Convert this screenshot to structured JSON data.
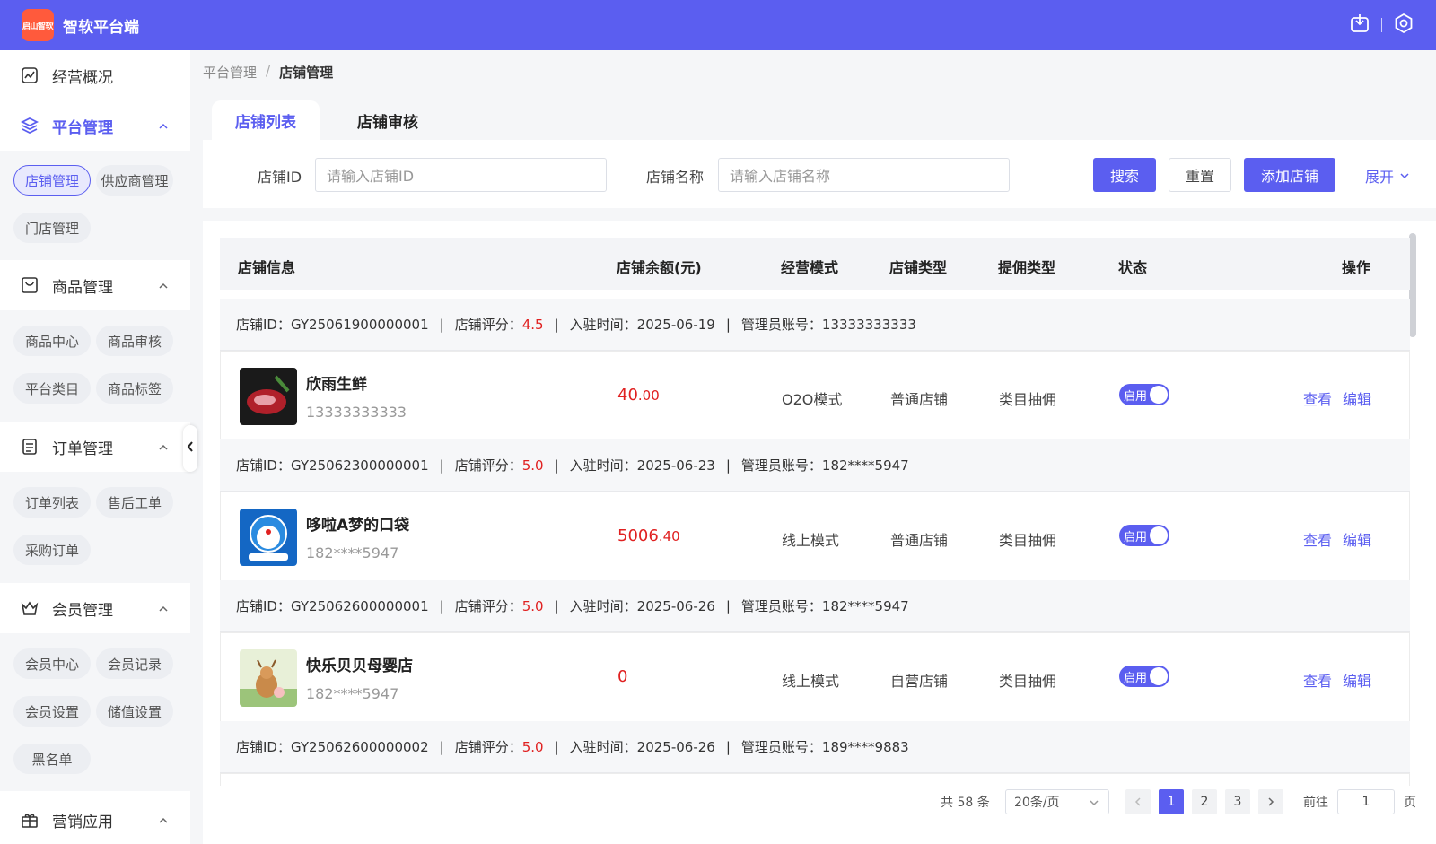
{
  "header": {
    "logo_text": "启山智软",
    "app_title": "智软平台端"
  },
  "sidebar": {
    "overview": "经营概况",
    "platform": {
      "label": "平台管理",
      "items": [
        "店铺管理",
        "供应商管理",
        "门店管理"
      ]
    },
    "goods": {
      "label": "商品管理",
      "items": [
        "商品中心",
        "商品审核",
        "平台类目",
        "商品标签"
      ]
    },
    "orders": {
      "label": "订单管理",
      "items": [
        "订单列表",
        "售后工单",
        "采购订单"
      ]
    },
    "members": {
      "label": "会员管理",
      "items": [
        "会员中心",
        "会员记录",
        "会员设置",
        "储值设置",
        "黑名单"
      ]
    },
    "marketing": {
      "label": "营销应用"
    }
  },
  "breadcrumb": {
    "parent": "平台管理",
    "sep": "/",
    "current": "店铺管理"
  },
  "tabs": [
    "店铺列表",
    "店铺审核"
  ],
  "filter": {
    "id_label": "店铺ID",
    "id_placeholder": "请输入店铺ID",
    "name_label": "店铺名称",
    "name_placeholder": "请输入店铺名称",
    "search": "搜索",
    "reset": "重置",
    "add": "添加店铺",
    "expand": "展开"
  },
  "table": {
    "columns": [
      "店铺信息",
      "店铺余额(元)",
      "经营模式",
      "店铺类型",
      "提佣类型",
      "状态",
      "操作"
    ],
    "meta_labels": {
      "id": "店铺ID：",
      "score": "店铺评分：",
      "joined": "入驻时间：",
      "admin": "管理员账号：",
      "bar": "|"
    },
    "rows": [
      {
        "id": "GY25061900000001",
        "score": "4.5",
        "joined": "2025-06-19",
        "admin": "13333333333",
        "name": "欣雨生鲜",
        "phone": "13333333333",
        "balance_int": "40",
        "balance_dec": ".00",
        "mode": "O2O模式",
        "type": "普通店铺",
        "commission": "类目抽佣",
        "status": "启用",
        "view": "查看",
        "edit": "编辑"
      },
      {
        "id": "GY25062300000001",
        "score": "5.0",
        "joined": "2025-06-23",
        "admin": "182****5947",
        "name": "哆啦A梦的口袋",
        "phone": "182****5947",
        "balance_int": "5006",
        "balance_dec": ".40",
        "mode": "线上模式",
        "type": "普通店铺",
        "commission": "类目抽佣",
        "status": "启用",
        "view": "查看",
        "edit": "编辑"
      },
      {
        "id": "GY25062600000001",
        "score": "5.0",
        "joined": "2025-06-26",
        "admin": "182****5947",
        "name": "快乐贝贝母婴店",
        "phone": "182****5947",
        "balance_int": "0",
        "balance_dec": "",
        "mode": "线上模式",
        "type": "自营店铺",
        "commission": "类目抽佣",
        "status": "启用",
        "view": "查看",
        "edit": "编辑"
      },
      {
        "id": "GY25062600000002",
        "score": "5.0",
        "joined": "2025-06-26",
        "admin": "189****9883"
      }
    ]
  },
  "pagination": {
    "total": "共 58 条",
    "page_size": "20条/页",
    "pages": [
      "1",
      "2",
      "3"
    ],
    "goto_label": "前往",
    "goto_value": "1",
    "page_suffix": "页"
  },
  "colors": {
    "primary": "#5b5ef0",
    "danger": "#e02020"
  }
}
